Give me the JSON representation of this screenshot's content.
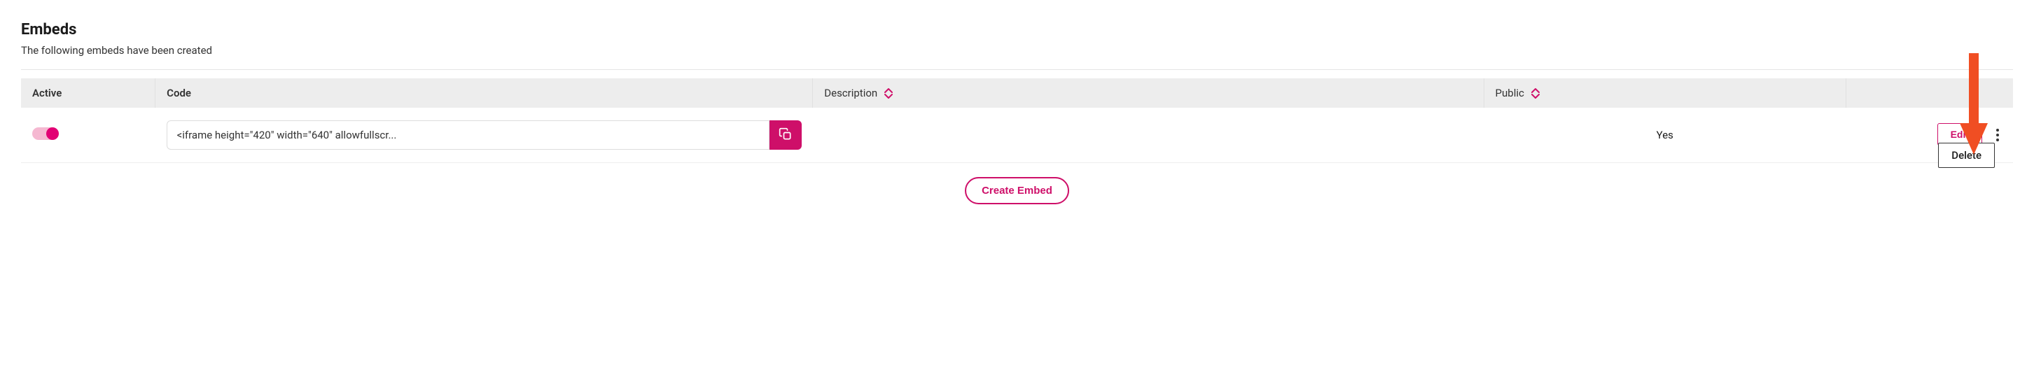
{
  "header": {
    "title": "Embeds",
    "subtitle": "The following embeds have been created"
  },
  "table": {
    "columns": {
      "active": "Active",
      "code": "Code",
      "description": "Description",
      "public": "Public"
    },
    "rows": [
      {
        "active": true,
        "code": "<iframe height=\"420\" width=\"640\" allowfullscr...",
        "description": "",
        "public": "Yes",
        "edit_label": "Edit"
      }
    ]
  },
  "dropdown": {
    "delete": "Delete"
  },
  "create_button": "Create Embed",
  "colors": {
    "accent": "#ce0f69"
  }
}
